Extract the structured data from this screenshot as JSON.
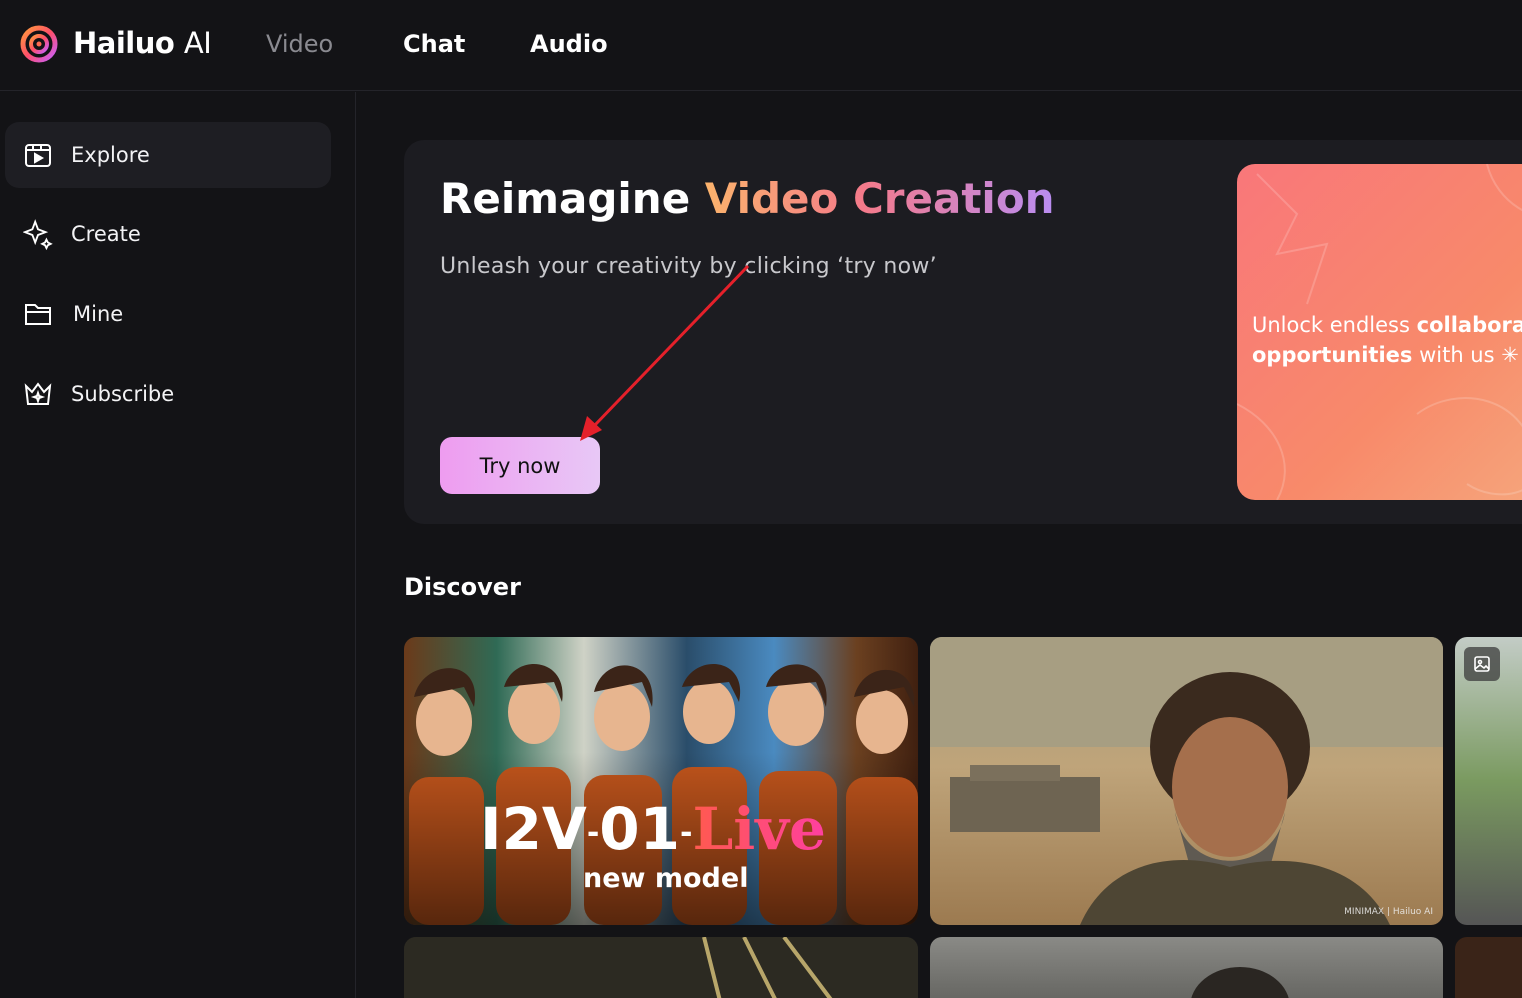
{
  "header": {
    "brand": "Hailuo",
    "brand_suffix": "AI",
    "nav": [
      {
        "label": "Video",
        "active": false
      },
      {
        "label": "Chat",
        "active": true
      },
      {
        "label": "Audio",
        "active": true
      }
    ]
  },
  "sidebar": {
    "items": [
      {
        "label": "Explore",
        "icon": "video-frame-icon",
        "active": true
      },
      {
        "label": "Create",
        "icon": "sparkle-icon",
        "active": false
      },
      {
        "label": "Mine",
        "icon": "folder-icon",
        "active": false
      },
      {
        "label": "Subscribe",
        "icon": "crown-icon",
        "active": false
      }
    ]
  },
  "hero": {
    "title_plain": "Reimagine ",
    "title_highlight": "Video Creation",
    "subtitle": "Unleash your creativity by clicking ‘try now’",
    "cta": "Try now",
    "banner_line1_a": "Unlock endless ",
    "banner_line1_b": "collaborat",
    "banner_line2_a": "opportunities",
    "banner_line2_b": " with us"
  },
  "discover": {
    "title": "Discover",
    "card1": {
      "model_a": "I2V",
      "model_b": "01",
      "model_c": "Live",
      "dash": "-",
      "subtitle": "new model"
    },
    "card2": {
      "watermark": "MINIMAX | Hailuo AI"
    }
  },
  "colors": {
    "background": "#131316",
    "hero_bg": "#1c1c21",
    "accent_gradient_start": "#fbb36c",
    "accent_gradient_end": "#b98df2",
    "cta_bg": "#ee9cf0",
    "annotation_arrow": "#e5202a"
  }
}
